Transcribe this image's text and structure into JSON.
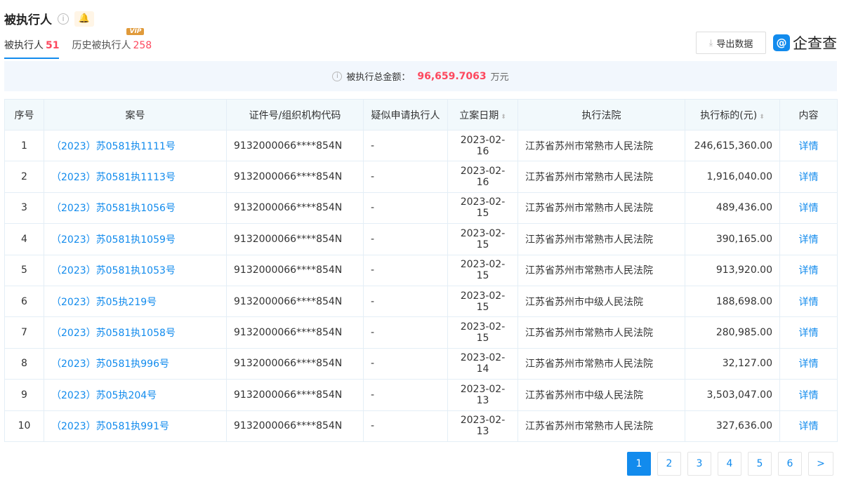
{
  "header": {
    "title": "被执行人",
    "info_icon": "i"
  },
  "tabs": [
    {
      "label": "被执行人",
      "count": "51"
    },
    {
      "label": "历史被执行人",
      "count": "258",
      "badge": "VIP"
    }
  ],
  "toolbar": {
    "export_label": "导出数据",
    "logo_text": "企查查"
  },
  "summary": {
    "label": "被执行总金额：",
    "amount": "96,659.7063",
    "unit": "万元"
  },
  "table": {
    "headers": [
      "序号",
      "案号",
      "证件号/组织机构代码",
      "疑似申请执行人",
      "立案日期",
      "执行法院",
      "执行标的(元)",
      "内容"
    ],
    "rows": [
      [
        "1",
        "（2023）苏0581执1111号",
        "9132000066****854N",
        "-",
        "2023-02-16",
        "江苏省苏州市常熟市人民法院",
        "246,615,360.00",
        "详情"
      ],
      [
        "2",
        "（2023）苏0581执1113号",
        "9132000066****854N",
        "-",
        "2023-02-16",
        "江苏省苏州市常熟市人民法院",
        "1,916,040.00",
        "详情"
      ],
      [
        "3",
        "（2023）苏0581执1056号",
        "9132000066****854N",
        "-",
        "2023-02-15",
        "江苏省苏州市常熟市人民法院",
        "489,436.00",
        "详情"
      ],
      [
        "4",
        "（2023）苏0581执1059号",
        "9132000066****854N",
        "-",
        "2023-02-15",
        "江苏省苏州市常熟市人民法院",
        "390,165.00",
        "详情"
      ],
      [
        "5",
        "（2023）苏0581执1053号",
        "9132000066****854N",
        "-",
        "2023-02-15",
        "江苏省苏州市常熟市人民法院",
        "913,920.00",
        "详情"
      ],
      [
        "6",
        "（2023）苏05执219号",
        "9132000066****854N",
        "-",
        "2023-02-15",
        "江苏省苏州市中级人民法院",
        "188,698.00",
        "详情"
      ],
      [
        "7",
        "（2023）苏0581执1058号",
        "9132000066****854N",
        "-",
        "2023-02-15",
        "江苏省苏州市常熟市人民法院",
        "280,985.00",
        "详情"
      ],
      [
        "8",
        "（2023）苏0581执996号",
        "9132000066****854N",
        "-",
        "2023-02-14",
        "江苏省苏州市常熟市人民法院",
        "32,127.00",
        "详情"
      ],
      [
        "9",
        "（2023）苏05执204号",
        "9132000066****854N",
        "-",
        "2023-02-13",
        "江苏省苏州市中级人民法院",
        "3,503,047.00",
        "详情"
      ],
      [
        "10",
        "（2023）苏0581执991号",
        "9132000066****854N",
        "-",
        "2023-02-13",
        "江苏省苏州市常熟市人民法院",
        "327,636.00",
        "详情"
      ]
    ]
  },
  "pagination": {
    "pages": [
      "1",
      "2",
      "3",
      "4",
      "5",
      "6"
    ],
    "current": "1",
    "next": ">"
  }
}
